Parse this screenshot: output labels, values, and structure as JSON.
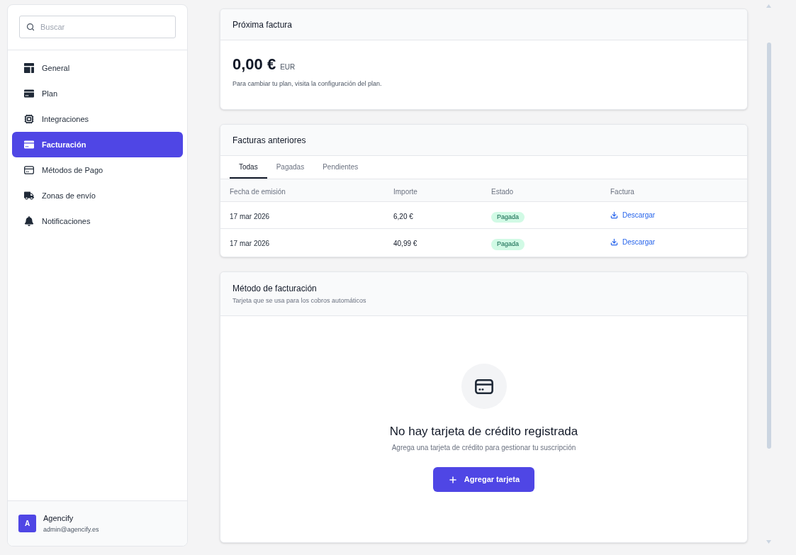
{
  "sidebar": {
    "search": {
      "placeholder": "Buscar"
    },
    "items": [
      {
        "label": "General",
        "selected": false
      },
      {
        "label": "Plan",
        "selected": false
      },
      {
        "label": "Integraciones",
        "selected": false
      },
      {
        "label": "Facturación",
        "selected": true
      },
      {
        "label": "Métodos de Pago",
        "selected": false
      },
      {
        "label": "Zonas de envío",
        "selected": false
      },
      {
        "label": "Notificaciones",
        "selected": false
      }
    ],
    "account": {
      "avatar": "A",
      "name": "Agencify",
      "email": "admin@agencify.es"
    }
  },
  "next_invoice": {
    "title": "Próxima factura",
    "amount": "0,00 €",
    "currency": "EUR",
    "note": "Para cambiar tu plan, visita la configuración del plan."
  },
  "past_invoices": {
    "title": "Facturas anteriores",
    "tabs": [
      {
        "label": "Todas",
        "selected": true
      },
      {
        "label": "Pagadas",
        "selected": false
      },
      {
        "label": "Pendientes",
        "selected": false
      }
    ],
    "columns": [
      "Fecha de emisión",
      "Importe",
      "Estado",
      "Factura"
    ],
    "rows": [
      {
        "date": "17 mar 2026",
        "amount": "6,20 €",
        "status": "Pagada",
        "action": "Descargar"
      },
      {
        "date": "17 mar 2026",
        "amount": "40,99 €",
        "status": "Pagada",
        "action": "Descargar"
      }
    ]
  },
  "billing_method": {
    "title": "Método de facturación",
    "subtitle": "Tarjeta que se usa para los cobros automáticos",
    "empty_state": {
      "title": "No hay tarjeta de crédito registrada",
      "text": "Agrega una tarjeta de crédito para gestionar tu suscripción",
      "button": "Agregar tarjeta"
    }
  }
}
